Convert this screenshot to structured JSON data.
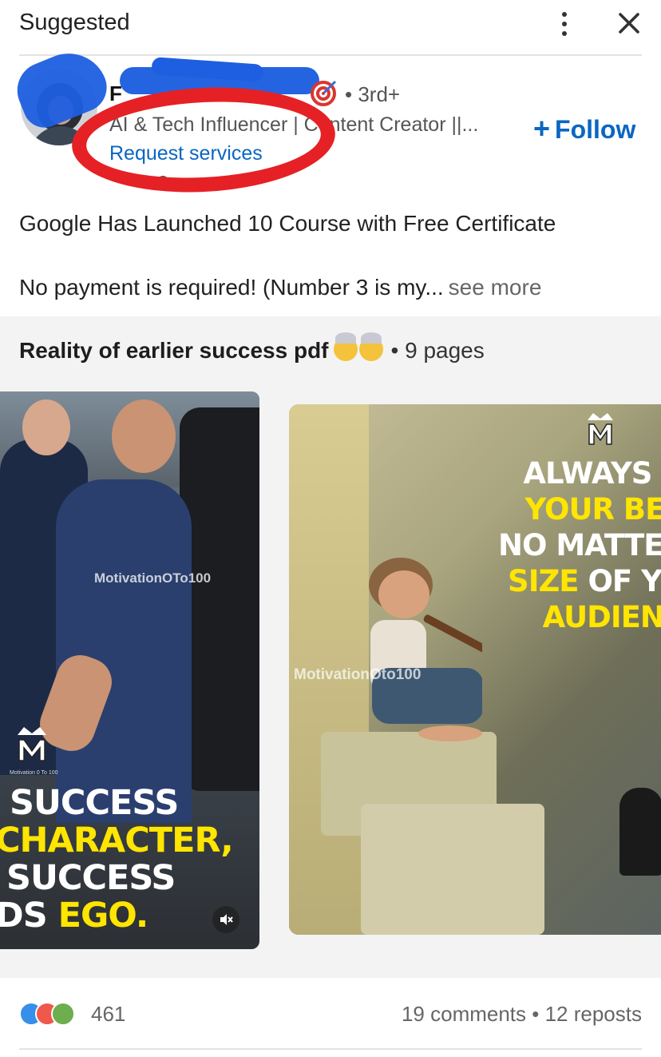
{
  "header": {
    "title": "Suggested",
    "more_icon": "more-vertical-icon",
    "close_icon": "close-icon"
  },
  "author": {
    "name_initial": "F",
    "degree": "• 3rd+",
    "headline": "AI & Tech Influencer | Content Creator ||...",
    "action_link": "Request services",
    "follow_label": "Follow",
    "follow_icon": "plus-icon"
  },
  "post": {
    "line1": "Google Has Launched 10 Course with Free Certificate",
    "line2": "No payment is required! (Number 3 is my...",
    "see_more": "see more"
  },
  "document": {
    "title": "Reality of earlier success pdf",
    "pages": "• 9 pages",
    "slides": [
      {
        "watermark": "MotivationOTo100",
        "logo_sub": "Motivation 0 To 100",
        "quote_line1": "SUCCESS",
        "quote_line2": "CHARACTER,",
        "quote_line3": "SUCCESS",
        "quote_line4_white": "DS ",
        "quote_line4_yellow": "EGO."
      },
      {
        "watermark": "MotivationOto100",
        "quote_line1": "ALWAYS D",
        "quote_line2": "YOUR BES",
        "quote_line3": "NO MATTER",
        "quote_line4_yellow": "SIZE",
        "quote_line4_white": " OF YO",
        "quote_line5": "AUDIENC"
      }
    ]
  },
  "social": {
    "reaction_count": "461",
    "comments_reposts": "19 comments • 12 reposts"
  },
  "colors": {
    "link_blue": "#0a66c2",
    "annotation_red": "#e52125",
    "redaction_blue": "#1d5fe0",
    "quote_yellow": "#ffe500"
  }
}
